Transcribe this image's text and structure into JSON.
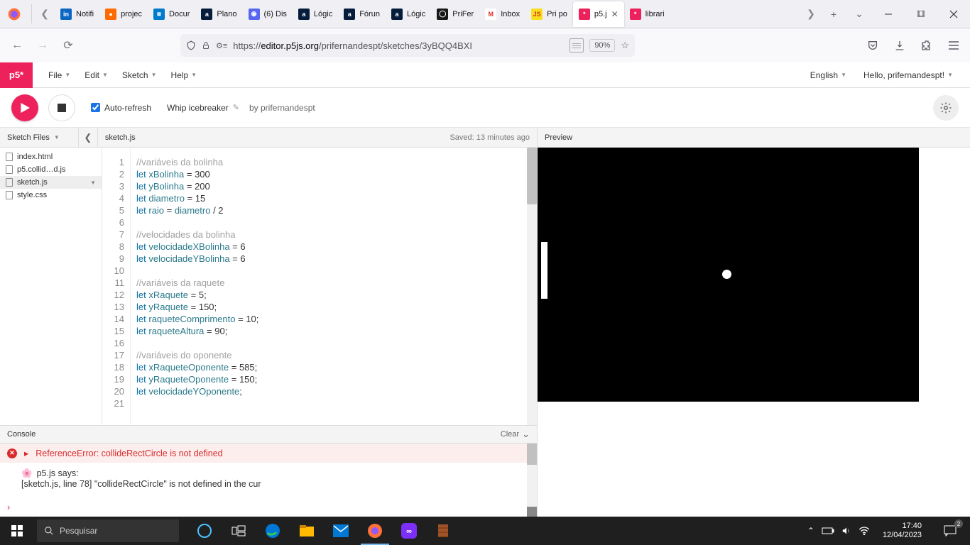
{
  "browser": {
    "tabs": [
      {
        "label": "Notifi",
        "favicon_bg": "#0a66c2",
        "favicon_text": "in",
        "active": false
      },
      {
        "label": "projec",
        "favicon_bg": "#ff6a00",
        "favicon_text": "●",
        "active": false
      },
      {
        "label": "Docur",
        "favicon_bg": "#007acc",
        "favicon_text": "⧈",
        "active": false
      },
      {
        "label": "Plano",
        "favicon_bg": "#051d3b",
        "favicon_text": "a",
        "active": false
      },
      {
        "label": "(6) Dis",
        "favicon_bg": "#5865f2",
        "favicon_text": "◉",
        "active": false
      },
      {
        "label": "Lógic",
        "favicon_bg": "#051d3b",
        "favicon_text": "a",
        "active": false
      },
      {
        "label": "Fórun",
        "favicon_bg": "#051d3b",
        "favicon_text": "a",
        "active": false
      },
      {
        "label": "Lógic",
        "favicon_bg": "#051d3b",
        "favicon_text": "a",
        "active": false
      },
      {
        "label": "PriFer",
        "favicon_bg": "#181717",
        "favicon_text": "◯",
        "active": false
      },
      {
        "label": "Inbox",
        "favicon_bg": "#fff",
        "favicon_text": "M",
        "active": false
      },
      {
        "label": "Pri po",
        "favicon_bg": "#f7df1e",
        "favicon_text": "JS",
        "active": false
      },
      {
        "label": "p5.j",
        "favicon_bg": "#ed225d",
        "favicon_text": "*",
        "active": true
      },
      {
        "label": "librari",
        "favicon_bg": "#ed225d",
        "favicon_text": "*",
        "active": false
      }
    ],
    "url_prefix": "https://",
    "url_host": "editor.p5js.org",
    "url_path": "/prifernandespt/sketches/3yBQQ4BXI",
    "zoom": "90%"
  },
  "p5": {
    "logo": "p5*",
    "menu": [
      "File",
      "Edit",
      "Sketch",
      "Help"
    ],
    "language": "English",
    "greeting": "Hello, prifernandespt!",
    "auto_refresh_label": "Auto-refresh",
    "auto_refresh_checked": true,
    "sketch_name": "Whip icebreaker",
    "by": "by",
    "author": "prifernandespt"
  },
  "files": {
    "header": "Sketch Files",
    "list": [
      {
        "name": "index.html",
        "active": false
      },
      {
        "name": "p5.collid…d.js",
        "active": false
      },
      {
        "name": "sketch.js",
        "active": true
      },
      {
        "name": "style.css",
        "active": false
      }
    ],
    "current_file": "sketch.js",
    "saved_status": "Saved: 13 minutes ago"
  },
  "code": {
    "lines": [
      {
        "n": 1,
        "html": "<span class='cm'>//variáveis da bolinha</span>"
      },
      {
        "n": 2,
        "html": "<span class='kw'>let</span> <span class='vr'>xBolinha</span> = <span class='nm'>300</span>"
      },
      {
        "n": 3,
        "html": "<span class='kw'>let</span> <span class='vr'>yBolinha</span> = <span class='nm'>200</span>"
      },
      {
        "n": 4,
        "html": "<span class='kw'>let</span> <span class='vr'>diametro</span> = <span class='nm'>15</span>"
      },
      {
        "n": 5,
        "html": "<span class='kw'>let</span> <span class='vr'>raio</span> = <span class='vr'>diametro</span> / <span class='nm'>2</span>"
      },
      {
        "n": 6,
        "html": ""
      },
      {
        "n": 7,
        "html": "<span class='cm'>//velocidades da bolinha</span>"
      },
      {
        "n": 8,
        "html": "<span class='kw'>let</span> <span class='vr'>velocidadeXBolinha</span> = <span class='nm'>6</span>"
      },
      {
        "n": 9,
        "html": "<span class='kw'>let</span> <span class='vr'>velocidadeYBolinha</span> = <span class='nm'>6</span>"
      },
      {
        "n": 10,
        "html": ""
      },
      {
        "n": 11,
        "html": "<span class='cm'>//variáveis da raquete</span>"
      },
      {
        "n": 12,
        "html": "<span class='kw'>let</span> <span class='vr'>xRaquete</span> = <span class='nm'>5</span>;"
      },
      {
        "n": 13,
        "html": "<span class='kw'>let</span> <span class='vr'>yRaquete</span> = <span class='nm'>150</span>;"
      },
      {
        "n": 14,
        "html": "<span class='kw'>let</span> <span class='vr'>raqueteComprimento</span> = <span class='nm'>10</span>;"
      },
      {
        "n": 15,
        "html": "<span class='kw'>let</span> <span class='vr'>raqueteAltura</span> = <span class='nm'>90</span>;"
      },
      {
        "n": 16,
        "html": ""
      },
      {
        "n": 17,
        "html": "<span class='cm'>//variáveis do oponente</span>"
      },
      {
        "n": 18,
        "html": "<span class='kw'>let</span> <span class='vr'>xRaqueteOponente</span> = <span class='nm'>585</span>;"
      },
      {
        "n": 19,
        "html": "<span class='kw'>let</span> <span class='vr'>yRaqueteOponente</span> = <span class='nm'>150</span>;"
      },
      {
        "n": 20,
        "html": "<span class='kw'>let</span> <span class='vr'>velocidadeYOponente</span>;"
      },
      {
        "n": 21,
        "html": ""
      }
    ]
  },
  "console": {
    "title": "Console",
    "clear": "Clear",
    "error": "ReferenceError: collideRectCircle is not defined",
    "msg_line1": "p5.js says:",
    "msg_line2": "[sketch.js, line 78] \"collideRectCircle\" is not defined in the cur"
  },
  "preview": {
    "title": "Preview"
  },
  "taskbar": {
    "search_placeholder": "Pesquisar",
    "time": "17:40",
    "date": "12/04/2023",
    "notif_count": "2"
  }
}
